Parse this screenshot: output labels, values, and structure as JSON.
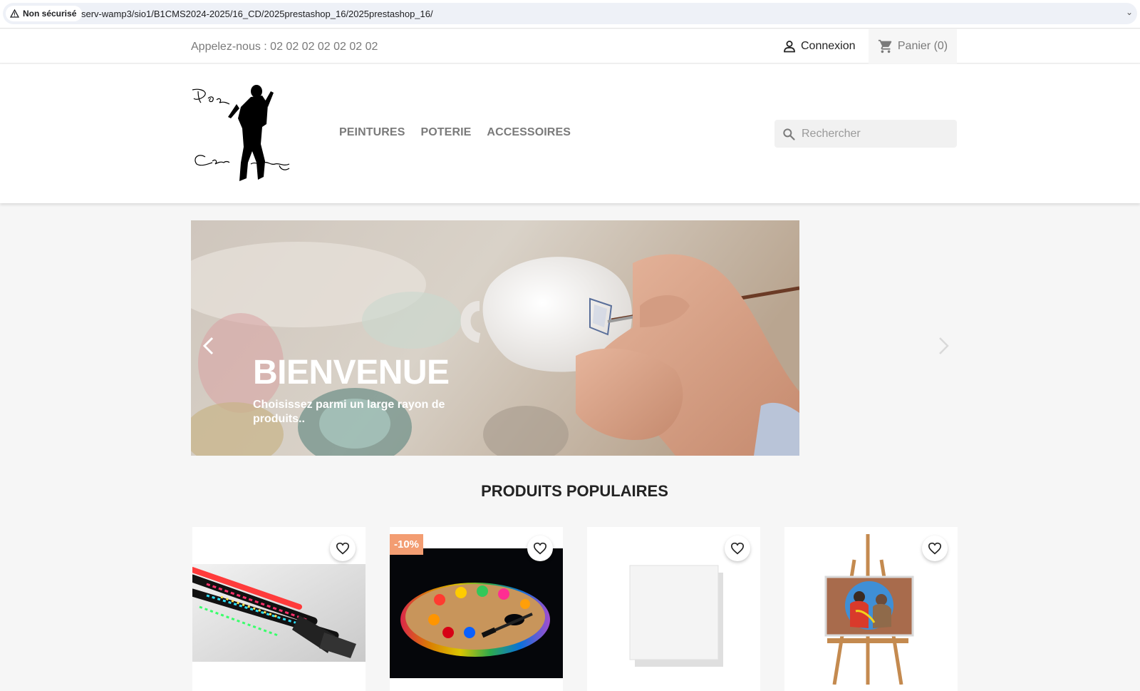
{
  "browser": {
    "security_label": "Non sécurisé",
    "url": "serv-wamp3/sio1/B1CMS2024-2025/16_CD/2025prestashop_16/2025prestashop_16/"
  },
  "topnav": {
    "phone": "Appelez-nous : 02 02 02 02 02 02 02",
    "login_label": "Connexion",
    "cart_label": "Panier (0)"
  },
  "header": {
    "logo_icon": "silhouette-logo",
    "menu": [
      {
        "label": "PEINTURES"
      },
      {
        "label": "POTERIE"
      },
      {
        "label": "ACCESSOIRES"
      }
    ],
    "search_placeholder": "Rechercher"
  },
  "slider": {
    "title": "BIENVENUE",
    "subtitle": "Choisissez parmi un large rayon de produits.."
  },
  "products_section": {
    "title": "PRODUITS POPULAIRES",
    "products": [
      {
        "image": "led-brushes",
        "badge": ""
      },
      {
        "image": "led-palette",
        "badge": "-10%"
      },
      {
        "image": "blank-canvas",
        "badge": ""
      },
      {
        "image": "easel-painting",
        "badge": ""
      }
    ]
  },
  "colors": {
    "accent_badge": "#f39d72",
    "menu_text": "#7a7a7a",
    "page_bg": "#f6f6f6"
  }
}
